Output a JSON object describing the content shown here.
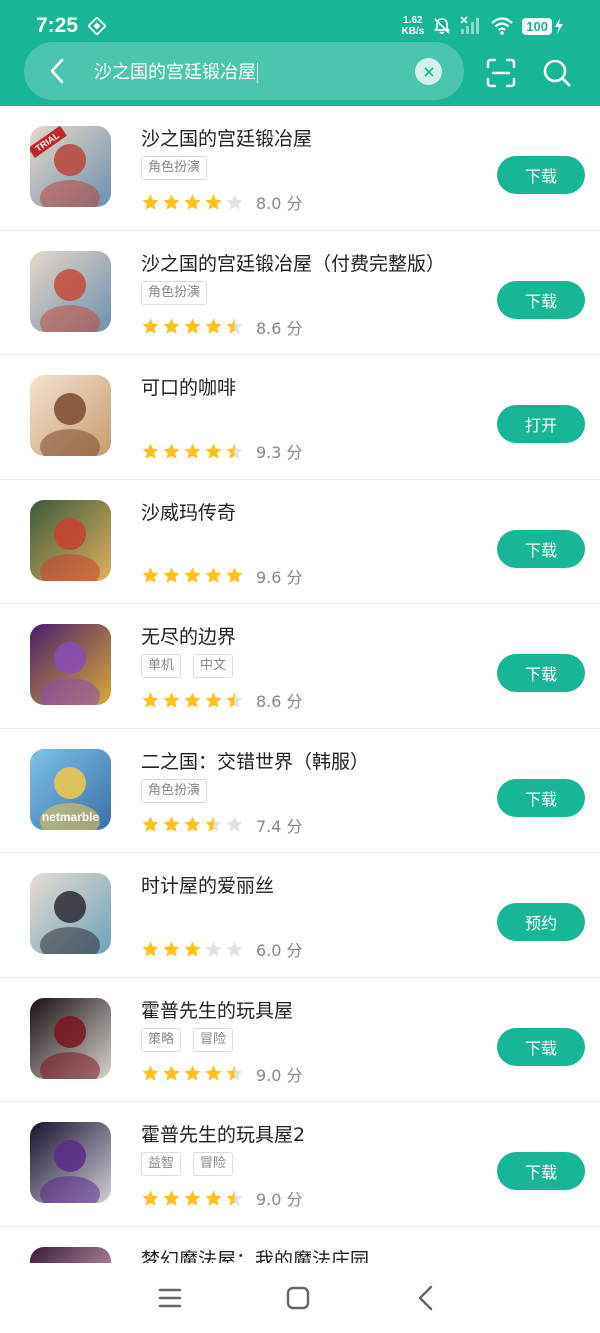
{
  "status": {
    "time": "7:25",
    "net_speed_value": "1.62",
    "net_speed_unit": "KB/s",
    "battery": "100"
  },
  "search": {
    "query": "沙之国的宫廷锻冶屋"
  },
  "apps": [
    {
      "name": "沙之国的宫廷锻冶屋",
      "tags": [
        "角色扮演"
      ],
      "stars": 4,
      "score": "8.0 分",
      "action": "下载",
      "icon_colors": [
        "#e7d8c7",
        "#b8453a",
        "#6b8fb0"
      ],
      "icon_badge": "TRIAL"
    },
    {
      "name": "沙之国的宫廷锻冶屋（付费完整版）",
      "tags": [
        "角色扮演"
      ],
      "stars": 4.5,
      "score": "8.6 分",
      "action": "下载",
      "icon_colors": [
        "#e7d8c7",
        "#c34a39",
        "#6b8fb0"
      ]
    },
    {
      "name": "可口的咖啡",
      "tags": [],
      "stars": 4.5,
      "score": "9.3 分",
      "action": "打开",
      "icon_colors": [
        "#f3e3d1",
        "#7a4a2e",
        "#c89a6e"
      ]
    },
    {
      "name": "沙威玛传奇",
      "tags": [],
      "stars": 5,
      "score": "9.6 分",
      "action": "下载",
      "icon_colors": [
        "#3d5a3b",
        "#c8402f",
        "#e0b060"
      ]
    },
    {
      "name": "无尽的边界",
      "tags": [
        "单机",
        "中文"
      ],
      "stars": 4.5,
      "score": "8.6 分",
      "action": "下载",
      "icon_colors": [
        "#4a1f6b",
        "#8a4bb8",
        "#d8a83a"
      ]
    },
    {
      "name": "二之国：交错世界（韩服）",
      "tags": [
        "角色扮演"
      ],
      "stars": 3.5,
      "score": "7.4 分",
      "action": "下载",
      "icon_colors": [
        "#7ec3e8",
        "#f2c94c",
        "#3b6ea8"
      ],
      "icon_caption": "netmarble"
    },
    {
      "name": "时计屋的爱丽丝",
      "tags": [],
      "stars": 3,
      "score": "6.0 分",
      "action": "预约",
      "icon_colors": [
        "#e9dbd2",
        "#2d2a34",
        "#6aa3b8"
      ]
    },
    {
      "name": "霍普先生的玩具屋",
      "tags": [
        "策略",
        "冒险"
      ],
      "stars": 4.5,
      "score": "9.0 分",
      "action": "下载",
      "icon_colors": [
        "#1a0f12",
        "#7a1420",
        "#d9d4cf"
      ]
    },
    {
      "name": "霍普先生的玩具屋2",
      "tags": [
        "益智",
        "冒险"
      ],
      "stars": 4.5,
      "score": "9.0 分",
      "action": "下载",
      "icon_colors": [
        "#1a1030",
        "#5a2a8a",
        "#d0d0d8"
      ]
    },
    {
      "name": "梦幻魔法屋：我的魔法庄园",
      "tags": [],
      "stars": 0,
      "score": "",
      "action": "",
      "icon_colors": [
        "#3a1a3a",
        "#c04a7a",
        "#e8c0d0"
      ]
    }
  ],
  "colors": {
    "brand": "#19b597",
    "star_on": "#ffc21c",
    "star_off": "#e3e3e3"
  },
  "icons": {
    "back": "chevron-left-icon",
    "clear": "close-icon",
    "scan": "scan-icon",
    "search": "search-icon",
    "nav_menu": "menu-icon",
    "nav_home": "home-icon",
    "nav_back": "back-icon"
  }
}
